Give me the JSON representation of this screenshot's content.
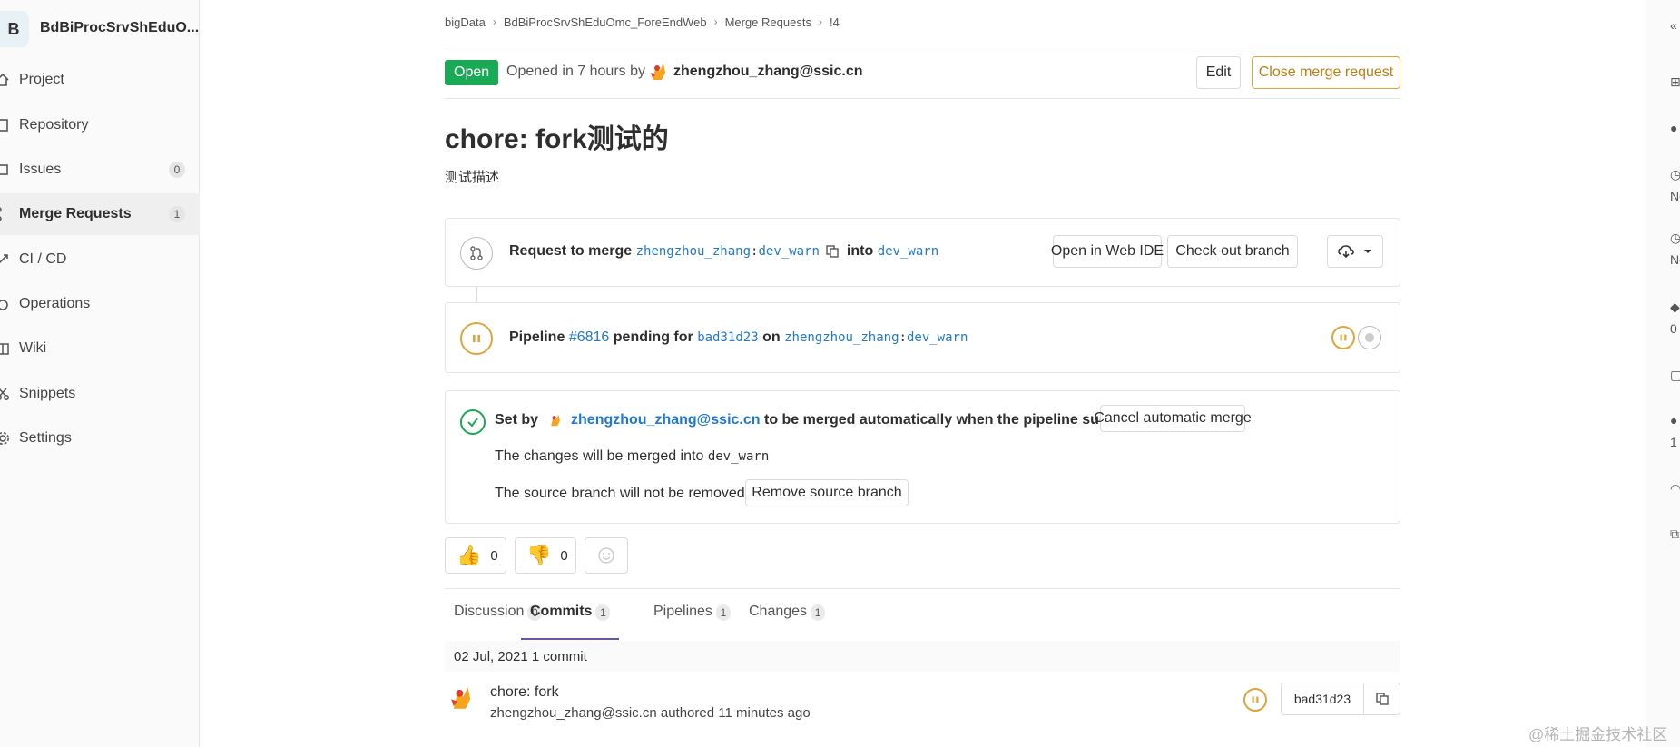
{
  "sidebar": {
    "avatar_letter": "B",
    "project_name": "BdBiProcSrvShEduO...",
    "items": [
      {
        "label": "Project",
        "icon": "home-icon"
      },
      {
        "label": "Repository",
        "icon": "book-icon"
      },
      {
        "label": "Issues",
        "icon": "issues-icon",
        "count": "0"
      },
      {
        "label": "Merge Requests",
        "icon": "merge-request-icon",
        "count": "1",
        "active": true
      },
      {
        "label": "CI / CD",
        "icon": "rocket-icon"
      },
      {
        "label": "Operations",
        "icon": "cloud-gear-icon"
      },
      {
        "label": "Wiki",
        "icon": "book-open-icon"
      },
      {
        "label": "Snippets",
        "icon": "scissors-icon"
      },
      {
        "label": "Settings",
        "icon": "gear-icon"
      }
    ]
  },
  "breadcrumb": [
    "bigData",
    "BdBiProcSrvShEduOmc_ForeEndWeb",
    "Merge Requests",
    "!4"
  ],
  "header": {
    "status": "Open",
    "opened_text": "Opened in 7 hours by",
    "author": "zhengzhou_zhang@ssic.cn",
    "edit_label": "Edit",
    "close_label": "Close merge request"
  },
  "mr": {
    "title": "chore: fork测试的",
    "description": "测试描述"
  },
  "merge_widget": {
    "prefix": "Request to merge",
    "source_namespace": "zhengzhou_zhang",
    "source_branch": "dev_warn",
    "into": "into",
    "target_branch": "dev_warn",
    "web_ide_label": "Open in Web IDE",
    "checkout_label": "Check out branch"
  },
  "pipeline": {
    "label": "Pipeline",
    "id": "#6816",
    "status_text": "pending for",
    "commit": "bad31d23",
    "on": "on",
    "namespace": "zhengzhou_zhang",
    "branch": "dev_warn"
  },
  "auto_merge": {
    "set_by": "Set by",
    "user": "zhengzhou_zhang@ssic.cn",
    "message": "to be merged automatically when the pipeline succeeds",
    "cancel_label": "Cancel automatic merge",
    "merged_into_text": "The changes will be merged into",
    "merged_into_branch": "dev_warn",
    "source_branch_text": "The source branch will not be removed",
    "remove_source_label": "Remove source branch"
  },
  "reactions": {
    "thumbs_up": "0",
    "thumbs_down": "0"
  },
  "tabs": [
    {
      "label": "Discussion",
      "count": "0"
    },
    {
      "label": "Commits",
      "count": "1",
      "active": true
    },
    {
      "label": "Pipelines",
      "count": "1"
    },
    {
      "label": "Changes",
      "count": "1"
    }
  ],
  "commits": {
    "date_label": "02 Jul, 2021",
    "count_label": "1 commit",
    "items": [
      {
        "title": "chore: fork",
        "author": "zhengzhou_zhang@ssic.cn",
        "authored_text": "authored",
        "time": "11 minutes ago",
        "sha": "bad31d23"
      }
    ]
  },
  "right_sidebar": {
    "time_estimate": "Nor",
    "time_spent": "Nor",
    "labels_count": "0",
    "participants_count": "1"
  },
  "watermark": "@稀土掘金技术社区",
  "colors": {
    "open_badge": "#1aaa55",
    "link": "#1f78d1",
    "pending": "#e0a43a",
    "active_tab_border": "#6b4fbb"
  }
}
